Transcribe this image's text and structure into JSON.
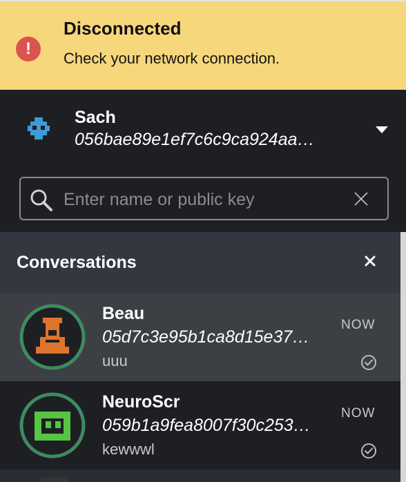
{
  "banner": {
    "title": "Disconnected",
    "message": "Check your network connection.",
    "icon": "alert-icon",
    "color": "#f6d77c"
  },
  "profile": {
    "name": "Sach",
    "public_key": "056bae89e1ef7c6c9ca924aa…",
    "avatar_color": "#3f9bd6",
    "menu_icon": "chevron-down-icon"
  },
  "search": {
    "placeholder": "Enter name or public key",
    "value": "",
    "icon": "search-icon",
    "clear_icon": "close-icon"
  },
  "conversations": {
    "title": "Conversations",
    "close_icon": "close-icon",
    "items": [
      {
        "name": "Beau",
        "public_key": "05d7c3e95b1ca8d15e37…",
        "preview": "uuu",
        "time": "NOW",
        "selected": true,
        "avatar_color": "#e0742c",
        "ring_color": "#3f8a61"
      },
      {
        "name": "NeuroScr",
        "public_key": "059b1a9fea8007f30c253…",
        "preview": "kewwwl",
        "time": "NOW",
        "selected": false,
        "avatar_color": "#57c444",
        "ring_color": "#3f8a61"
      }
    ]
  }
}
